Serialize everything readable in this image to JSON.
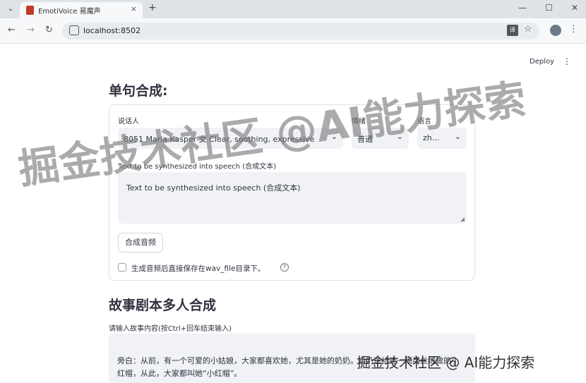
{
  "browser": {
    "tab_menu_icon": "⌄",
    "tab_title": "EmotiVoice 易魔声",
    "tab_close": "×",
    "new_tab": "+",
    "window_minimize": "—",
    "window_maximize": "☐",
    "window_close": "✕",
    "url": "localhost:8502",
    "translate_glyph": "译",
    "star_glyph": "☆",
    "menu_glyph": "⋮"
  },
  "app": {
    "deploy_label": "Deploy",
    "menu_glyph": "⋮"
  },
  "single": {
    "heading": "单句合成:",
    "speaker_label": "说话人",
    "speaker_value": "8051 Maria Kasper 女 Clear, soothing, expressive",
    "emotion_label": "情绪",
    "emotion_value": "普通",
    "language_label": "语言",
    "language_value": "zh...",
    "text_label": "Text to be synthesized into speech (合成文本)",
    "text_value": "Text to be synthesized into speech (合成文本)",
    "synth_button": "合成音频",
    "save_checkbox_label": "生成音频后直接保存在wav_file目录下。",
    "help_glyph": "?"
  },
  "story": {
    "heading": "故事剧本多人合成",
    "input_label": "请输入故事内容(按Ctrl+回车结束输入)",
    "story_text": "旁白：从前，有一个可爱的小姑娘，大家都喜欢她，尤其是她的奶奶。奶奶送给她一顶用丝绒做的小红帽，从此，大家都叫她“小红帽”。"
  },
  "watermark": {
    "main": "掘金技术社区 @AI能力探索",
    "corner": "掘金技术社区 @ AI能力探索"
  }
}
